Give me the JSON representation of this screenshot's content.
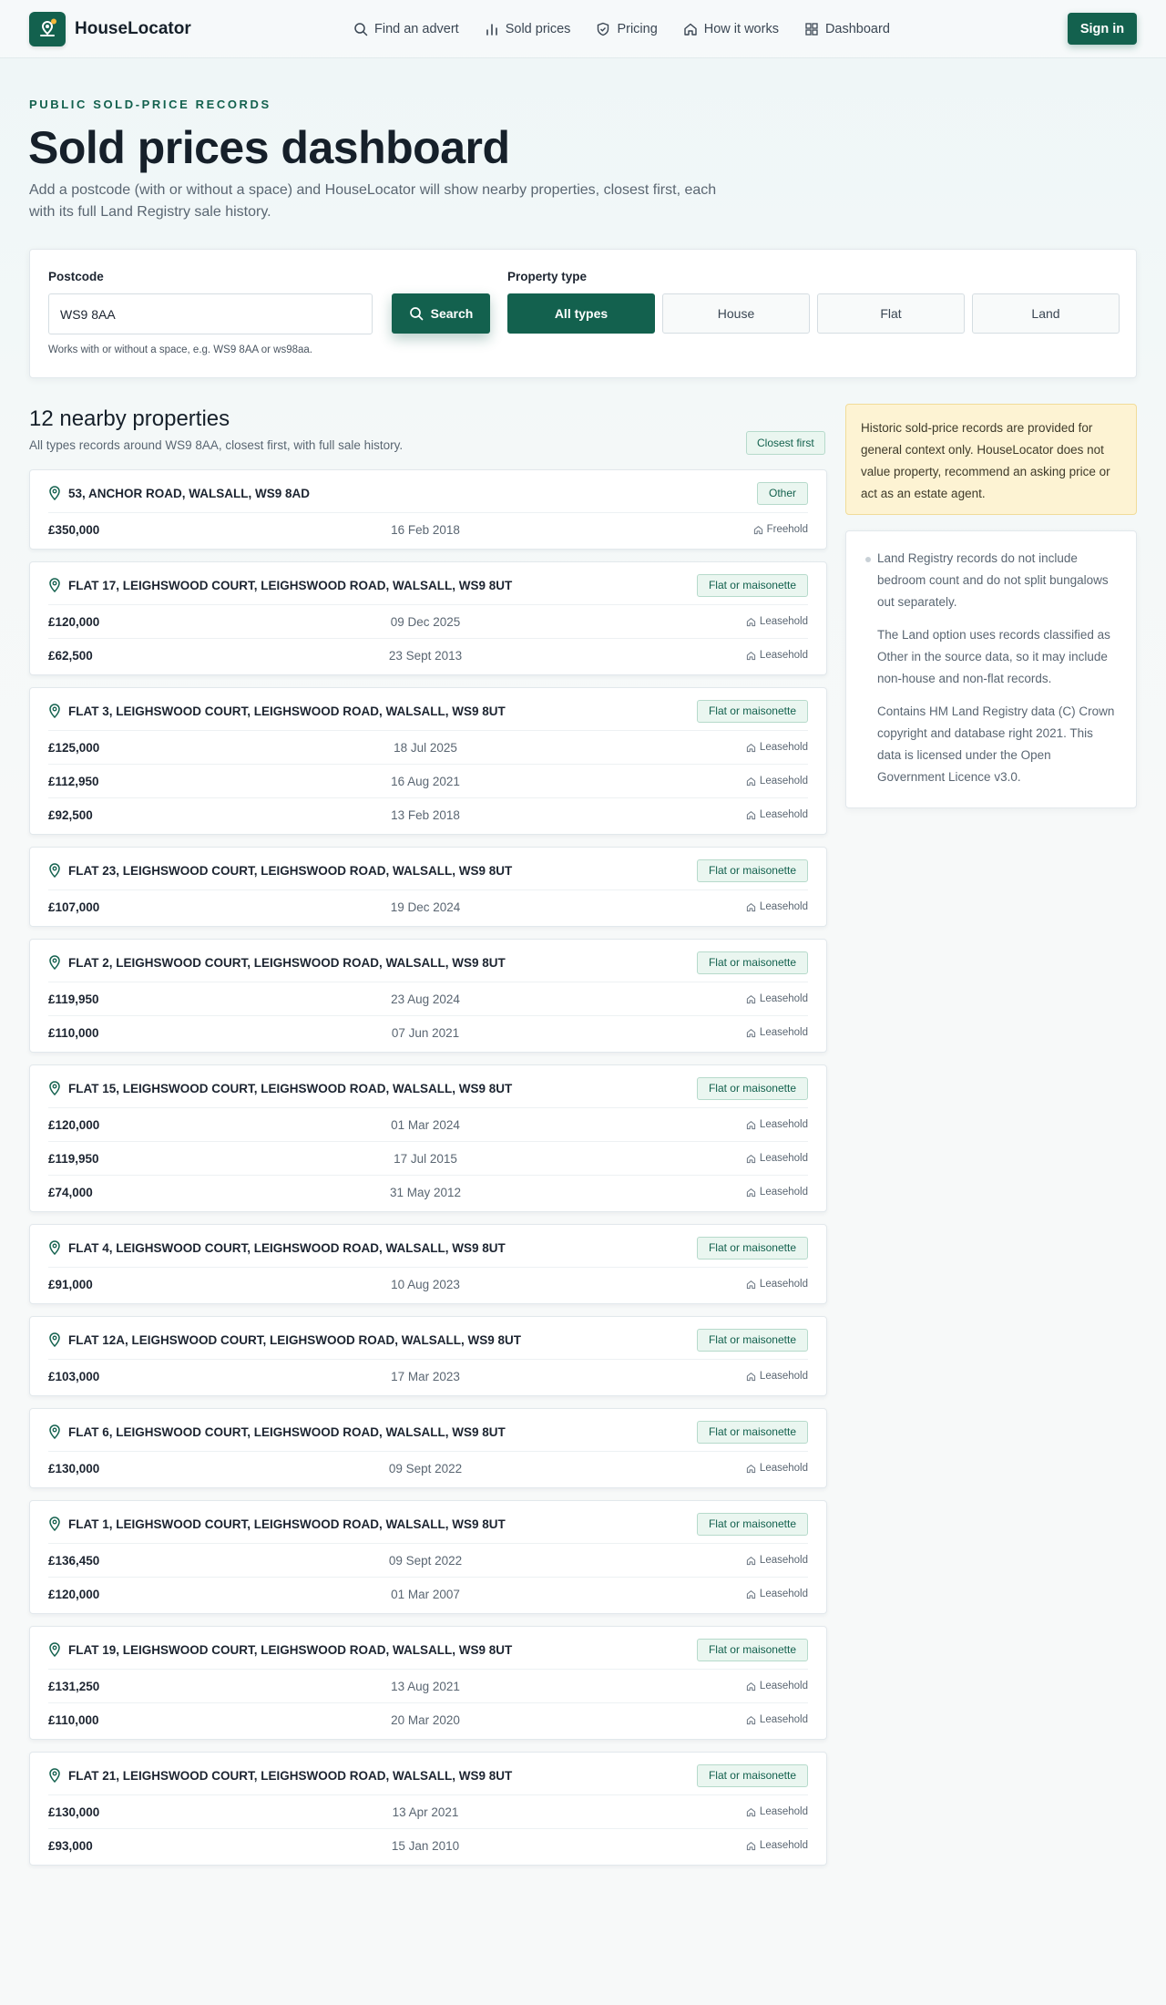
{
  "app": {
    "brand": "HouseLocator",
    "sign_in": "Sign in",
    "nav": [
      {
        "label": "Find an advert",
        "icon": "search-icon"
      },
      {
        "label": "Sold prices",
        "icon": "bar-chart-icon"
      },
      {
        "label": "Pricing",
        "icon": "shield-icon"
      },
      {
        "label": "How it works",
        "icon": "home-icon"
      },
      {
        "label": "Dashboard",
        "icon": "grid-icon"
      }
    ]
  },
  "hero": {
    "eyebrow": "PUBLIC SOLD-PRICE RECORDS",
    "title": "Sold prices dashboard",
    "intro": "Add a postcode (with or without a space) and HouseLocator will show nearby properties, closest first, each with its full Land Registry sale history."
  },
  "search": {
    "postcode_label": "Postcode",
    "postcode_value": "WS9 8AA",
    "hint": "Works with or without a space, e.g. WS9 8AA or ws98aa.",
    "search_label": "Search",
    "type_label": "Property type",
    "types": [
      "All types",
      "House",
      "Flat",
      "Land"
    ],
    "selected_type": "All types"
  },
  "results": {
    "title": "12 nearby properties",
    "subtitle": "All types records around WS9 8AA, closest first, with full sale history.",
    "order_badge": "Closest first",
    "properties": [
      {
        "address": "53, ANCHOR ROAD, WALSALL, WS9 8AD",
        "type": "Other",
        "sales": [
          {
            "price": "£350,000",
            "date": "16 Feb 2018",
            "tenure": "Freehold"
          }
        ]
      },
      {
        "address": "FLAT 17, LEIGHSWOOD COURT, LEIGHSWOOD ROAD, WALSALL, WS9 8UT",
        "type": "Flat or maisonette",
        "sales": [
          {
            "price": "£120,000",
            "date": "09 Dec 2025",
            "tenure": "Leasehold"
          },
          {
            "price": "£62,500",
            "date": "23 Sept 2013",
            "tenure": "Leasehold"
          }
        ]
      },
      {
        "address": "FLAT 3, LEIGHSWOOD COURT, LEIGHSWOOD ROAD, WALSALL, WS9 8UT",
        "type": "Flat or maisonette",
        "sales": [
          {
            "price": "£125,000",
            "date": "18 Jul 2025",
            "tenure": "Leasehold"
          },
          {
            "price": "£112,950",
            "date": "16 Aug 2021",
            "tenure": "Leasehold"
          },
          {
            "price": "£92,500",
            "date": "13 Feb 2018",
            "tenure": "Leasehold"
          }
        ]
      },
      {
        "address": "FLAT 23, LEIGHSWOOD COURT, LEIGHSWOOD ROAD, WALSALL, WS9 8UT",
        "type": "Flat or maisonette",
        "sales": [
          {
            "price": "£107,000",
            "date": "19 Dec 2024",
            "tenure": "Leasehold"
          }
        ]
      },
      {
        "address": "FLAT 2, LEIGHSWOOD COURT, LEIGHSWOOD ROAD, WALSALL, WS9 8UT",
        "type": "Flat or maisonette",
        "sales": [
          {
            "price": "£119,950",
            "date": "23 Aug 2024",
            "tenure": "Leasehold"
          },
          {
            "price": "£110,000",
            "date": "07 Jun 2021",
            "tenure": "Leasehold"
          }
        ]
      },
      {
        "address": "FLAT 15, LEIGHSWOOD COURT, LEIGHSWOOD ROAD, WALSALL, WS9 8UT",
        "type": "Flat or maisonette",
        "sales": [
          {
            "price": "£120,000",
            "date": "01 Mar 2024",
            "tenure": "Leasehold"
          },
          {
            "price": "£119,950",
            "date": "17 Jul 2015",
            "tenure": "Leasehold"
          },
          {
            "price": "£74,000",
            "date": "31 May 2012",
            "tenure": "Leasehold"
          }
        ]
      },
      {
        "address": "FLAT 4, LEIGHSWOOD COURT, LEIGHSWOOD ROAD, WALSALL, WS9 8UT",
        "type": "Flat or maisonette",
        "sales": [
          {
            "price": "£91,000",
            "date": "10 Aug 2023",
            "tenure": "Leasehold"
          }
        ]
      },
      {
        "address": "FLAT 12A, LEIGHSWOOD COURT, LEIGHSWOOD ROAD, WALSALL, WS9 8UT",
        "type": "Flat or maisonette",
        "sales": [
          {
            "price": "£103,000",
            "date": "17 Mar 2023",
            "tenure": "Leasehold"
          }
        ]
      },
      {
        "address": "FLAT 6, LEIGHSWOOD COURT, LEIGHSWOOD ROAD, WALSALL, WS9 8UT",
        "type": "Flat or maisonette",
        "sales": [
          {
            "price": "£130,000",
            "date": "09 Sept 2022",
            "tenure": "Leasehold"
          }
        ]
      },
      {
        "address": "FLAT 1, LEIGHSWOOD COURT, LEIGHSWOOD ROAD, WALSALL, WS9 8UT",
        "type": "Flat or maisonette",
        "sales": [
          {
            "price": "£136,450",
            "date": "09 Sept 2022",
            "tenure": "Leasehold"
          },
          {
            "price": "£120,000",
            "date": "01 Mar 2007",
            "tenure": "Leasehold"
          }
        ]
      },
      {
        "address": "FLAT 19, LEIGHSWOOD COURT, LEIGHSWOOD ROAD, WALSALL, WS9 8UT",
        "type": "Flat or maisonette",
        "sales": [
          {
            "price": "£131,250",
            "date": "13 Aug 2021",
            "tenure": "Leasehold"
          },
          {
            "price": "£110,000",
            "date": "20 Mar 2020",
            "tenure": "Leasehold"
          }
        ]
      },
      {
        "address": "FLAT 21, LEIGHSWOOD COURT, LEIGHSWOOD ROAD, WALSALL, WS9 8UT",
        "type": "Flat or maisonette",
        "sales": [
          {
            "price": "£130,000",
            "date": "13 Apr 2021",
            "tenure": "Leasehold"
          },
          {
            "price": "£93,000",
            "date": "15 Jan 2010",
            "tenure": "Leasehold"
          }
        ]
      }
    ]
  },
  "sidebar": {
    "notice": "Historic sold-price records are provided for general context only. HouseLocator does not value property, recommend an asking price or act as an estate agent.",
    "notes": [
      "Land Registry records do not include bedroom count and do not split bungalows out separately.",
      "The Land option uses records classified as Other in the source data, so it may include non-house and non-flat records.",
      "Contains HM Land Registry data (C) Crown copyright and database right 2021. This data is licensed under the Open Government Licence v3.0."
    ]
  },
  "colors": {
    "brand": "#13614e",
    "tag_bg": "#eaf6f0",
    "notice_bg": "#fdf3d3"
  }
}
